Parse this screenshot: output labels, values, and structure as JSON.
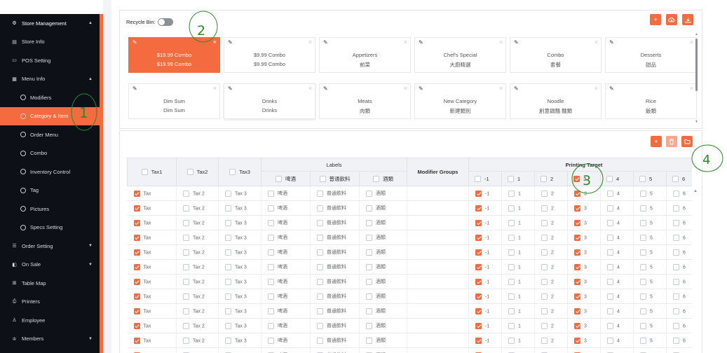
{
  "sidebar": {
    "items": [
      {
        "label": "Store Management",
        "icon": "gear-icon",
        "level": "group",
        "chevron": "up"
      },
      {
        "label": "Store Info",
        "icon": "document-icon",
        "level": "item"
      },
      {
        "label": "POS Setting",
        "icon": "monitor-icon",
        "level": "item"
      },
      {
        "label": "Menu Info",
        "icon": "menu-icon",
        "level": "item",
        "chevron": "up"
      },
      {
        "label": "Modifiers",
        "icon": "circle-icon",
        "level": "sub"
      },
      {
        "label": "Category & Item",
        "icon": "circle-icon",
        "level": "sub",
        "active": true
      },
      {
        "label": "Order Menu",
        "icon": "circle-icon",
        "level": "sub"
      },
      {
        "label": "Combo",
        "icon": "circle-icon",
        "level": "sub"
      },
      {
        "label": "Inventory Control",
        "icon": "circle-icon",
        "level": "sub"
      },
      {
        "label": "Tag",
        "icon": "circle-icon",
        "level": "sub"
      },
      {
        "label": "Pictures",
        "icon": "circle-icon",
        "level": "sub"
      },
      {
        "label": "Specs Setting",
        "icon": "circle-icon",
        "level": "sub"
      },
      {
        "label": "Order Setting",
        "icon": "list-icon",
        "level": "item",
        "chevron": "down"
      },
      {
        "label": "On Sale",
        "icon": "tag-icon",
        "level": "item",
        "chevron": "down"
      },
      {
        "label": "Table Map",
        "icon": "map-icon",
        "level": "item"
      },
      {
        "label": "Printers",
        "icon": "printer-icon",
        "level": "item"
      },
      {
        "label": "Employee",
        "icon": "user-icon",
        "level": "item"
      },
      {
        "label": "Members",
        "icon": "members-icon",
        "level": "item",
        "chevron": "down"
      }
    ]
  },
  "categories_panel": {
    "recycle_label": "Recycle Bin:",
    "recycle_on": false,
    "cards": [
      {
        "name": "$19.99 Combo",
        "alt": "$19.99 Combo",
        "selected": true
      },
      {
        "name": "$9.99 Combo",
        "alt": "$9.99 Combo"
      },
      {
        "name": "Appetizers",
        "alt": "前菜"
      },
      {
        "name": "Chef's Special",
        "alt": "大廚精選"
      },
      {
        "name": "Combo",
        "alt": "套餐"
      },
      {
        "name": "Desserts",
        "alt": "甜品"
      },
      {
        "name": "Dim Sum",
        "alt": "Dim Sum"
      },
      {
        "name": "Drinks",
        "alt": "Drinks"
      },
      {
        "name": "Meats",
        "alt": "肉類"
      },
      {
        "name": "New Category",
        "alt": "新建類別"
      },
      {
        "name": "Noodle",
        "alt": "創意鍋麵 麵類"
      },
      {
        "name": "Rice",
        "alt": "飯類"
      }
    ]
  },
  "items_table": {
    "headers": {
      "tax1": "Tax1",
      "tax2": "Tax2",
      "tax3": "Tax3",
      "labels": "Labels",
      "modifier_groups": "Modifier Groups",
      "printing_target": "Printing Target",
      "label_cols": [
        "啤酒",
        "普通飲料",
        "酒類"
      ],
      "printer_cols": [
        "-1",
        "1",
        "2",
        "3",
        "4",
        "5",
        "6"
      ]
    },
    "row_template": {
      "tax1": "Tax",
      "tax2": "Tax 2",
      "tax3": "Tax 3",
      "labels": [
        "啤酒",
        "普通飲料",
        "酒類"
      ],
      "printers": [
        "-1",
        "1",
        "2",
        "3",
        "4",
        "5",
        "6"
      ]
    },
    "row_count": 12
  },
  "annotations": [
    "1",
    "2",
    "3",
    "4"
  ],
  "colors": {
    "accent": "#f36b3f",
    "sidebar": "#0d1117",
    "annotation": "#2a8a2a"
  }
}
